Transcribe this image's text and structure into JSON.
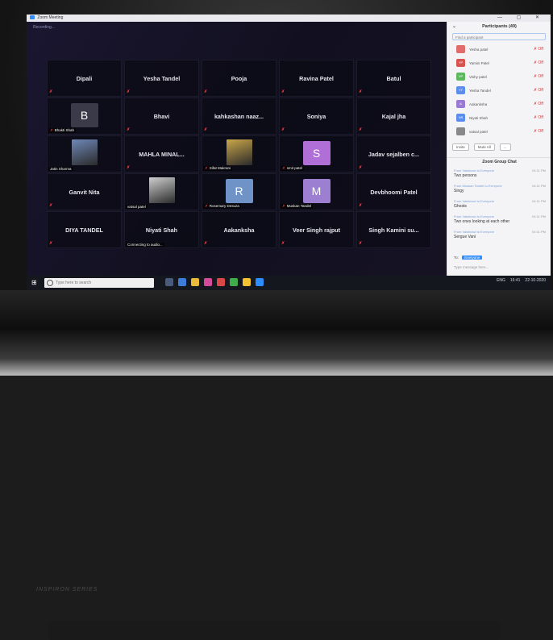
{
  "window": {
    "title": "Zoom Meeting",
    "controls": "— ▢ ✕"
  },
  "meeting": {
    "status": "Recording..."
  },
  "tiles": [
    {
      "name": "Dipali",
      "kind": "name",
      "muted": true,
      "label": ""
    },
    {
      "name": "Yesha Tandel",
      "kind": "name",
      "muted": true,
      "label": ""
    },
    {
      "name": "Pooja",
      "kind": "name",
      "muted": true,
      "label": ""
    },
    {
      "name": "Ravina Patel",
      "kind": "name",
      "muted": true,
      "label": ""
    },
    {
      "name": "Batul",
      "kind": "name",
      "muted": true,
      "label": ""
    },
    {
      "name": "B",
      "kind": "letter",
      "muted": true,
      "label": "Bhakti Shah",
      "color": "#3a3a48"
    },
    {
      "name": "Bhavi",
      "kind": "name",
      "muted": true,
      "label": ""
    },
    {
      "name": "kahkashan naaz...",
      "kind": "name",
      "muted": true,
      "label": ""
    },
    {
      "name": "Soniya",
      "kind": "name",
      "muted": true,
      "label": ""
    },
    {
      "name": "Kajal jha",
      "kind": "name",
      "muted": true,
      "label": ""
    },
    {
      "name": "",
      "kind": "photo",
      "muted": false,
      "label": "Jatin Sharma",
      "color": "#6f88b8"
    },
    {
      "name": "MAHLA MINAL...",
      "kind": "name",
      "muted": true,
      "label": ""
    },
    {
      "name": "",
      "kind": "photo",
      "muted": true,
      "label": "Sifat Makrani",
      "color": "#c9a64a"
    },
    {
      "name": "S",
      "kind": "letter",
      "muted": true,
      "label": "smit patel",
      "color": "#b06fd6"
    },
    {
      "name": "Jadav sejalben c...",
      "kind": "name",
      "muted": true,
      "label": ""
    },
    {
      "name": "Ganvit Nita",
      "kind": "name",
      "muted": true,
      "label": ""
    },
    {
      "name": "",
      "kind": "photo",
      "muted": false,
      "label": "vatsal patel",
      "color": "#cfcfcf"
    },
    {
      "name": "R",
      "kind": "letter",
      "muted": true,
      "label": "Rosemary Desuza",
      "color": "#6f93c6"
    },
    {
      "name": "M",
      "kind": "letter",
      "muted": true,
      "label": "Muskan Tandel",
      "color": "#9c7fd0"
    },
    {
      "name": "Devbhoomi Patel",
      "kind": "name",
      "muted": true,
      "label": ""
    },
    {
      "name": "DIYA TANDEL",
      "kind": "name",
      "muted": true,
      "label": ""
    },
    {
      "name": "Niyati Shah",
      "kind": "name",
      "muted": false,
      "label": "Connecting to audio..."
    },
    {
      "name": "Aakanksha",
      "kind": "name",
      "muted": true,
      "label": ""
    },
    {
      "name": "Veer Singh rajput",
      "kind": "name",
      "muted": true,
      "label": ""
    },
    {
      "name": "Singh Kamini su...",
      "kind": "name",
      "muted": true,
      "label": ""
    }
  ],
  "participants": {
    "title": "Participants (49)",
    "search_placeholder": "Find a participant",
    "rows": [
      {
        "initials": "",
        "name": "Yesha patel",
        "color": "#e06c6c"
      },
      {
        "initials": "YP",
        "name": "Yamini Patel",
        "color": "#d9534f"
      },
      {
        "initials": "VP",
        "name": "Vishy patel",
        "color": "#5cb85c"
      },
      {
        "initials": "YT",
        "name": "Yesha Tandel",
        "color": "#5b8def"
      },
      {
        "initials": "A",
        "name": "Aakanksha",
        "color": "#9b7ad6"
      },
      {
        "initials": "NS",
        "name": "Niyati Shah",
        "color": "#5b8def"
      },
      {
        "initials": "",
        "name": "vatsal patel",
        "color": "#888888"
      }
    ],
    "mute_label": "Off",
    "actions": {
      "invite": "Invite",
      "mute_all": "Mute All",
      "more": "..."
    }
  },
  "chat": {
    "title": "Zoom Group Chat",
    "messages": [
      {
        "from": "From Vaishnavi  to Everyone",
        "time": "04:11 PM",
        "text": "Two persons"
      },
      {
        "from": "From Muskan Tandel to Everyone",
        "time": "04:11 PM",
        "text": "Singy"
      },
      {
        "from": "From Vaishnavi to Everyone",
        "time": "04:11 PM",
        "text": "Ghosts"
      },
      {
        "from": "From Vaishnavi to Everyone",
        "time": "04:11 PM",
        "text": "Two ones looking at each other"
      },
      {
        "from": "From Vaishnavi to Everyone",
        "time": "04:11 PM",
        "text": "Sergue Vani"
      }
    ],
    "to_label": "To:",
    "to_value": "Everyone",
    "input_placeholder": "Type message here..."
  },
  "taskbar": {
    "search_placeholder": "Type here to search",
    "time": "16:41",
    "date": "22-10-2020",
    "lang": "ENG"
  },
  "laptop": {
    "brand": "INSPIRON SERIES"
  }
}
